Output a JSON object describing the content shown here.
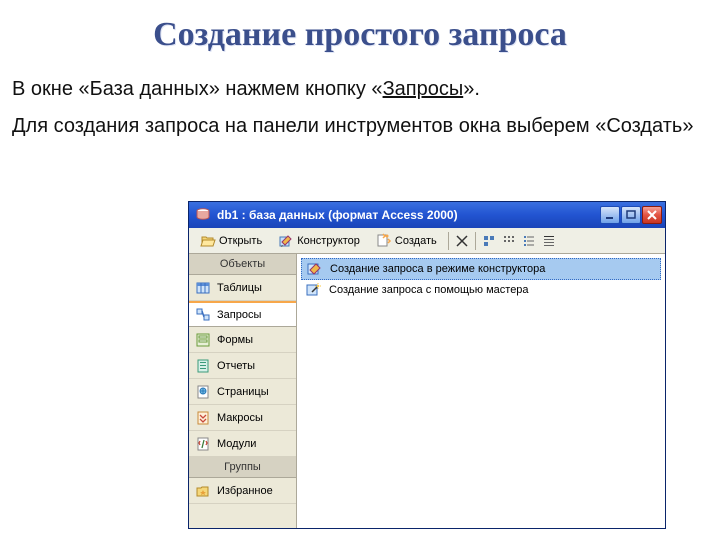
{
  "slide": {
    "title": "Создание простого запроса",
    "para1_prefix": "В окне «База данных» нажмем кнопку «",
    "para1_underlined": "Запросы",
    "para1_suffix": "».",
    "para2": "Для создания запроса на панели инструментов окна выберем «Создать»"
  },
  "window": {
    "title": "db1 : база данных (формат Access 2000)"
  },
  "toolbar": {
    "open": "Открыть",
    "design": "Конструктор",
    "create": "Создать"
  },
  "sidebar": {
    "header_objects": "Объекты",
    "items": [
      {
        "label": "Таблицы"
      },
      {
        "label": "Запросы"
      },
      {
        "label": "Формы"
      },
      {
        "label": "Отчеты"
      },
      {
        "label": "Страницы"
      },
      {
        "label": "Макросы"
      },
      {
        "label": "Модули"
      }
    ],
    "header_groups": "Группы",
    "favorites": "Избранное"
  },
  "main": {
    "items": [
      {
        "label": "Создание запроса в режиме конструктора"
      },
      {
        "label": "Создание запроса с помощью мастера"
      }
    ]
  }
}
